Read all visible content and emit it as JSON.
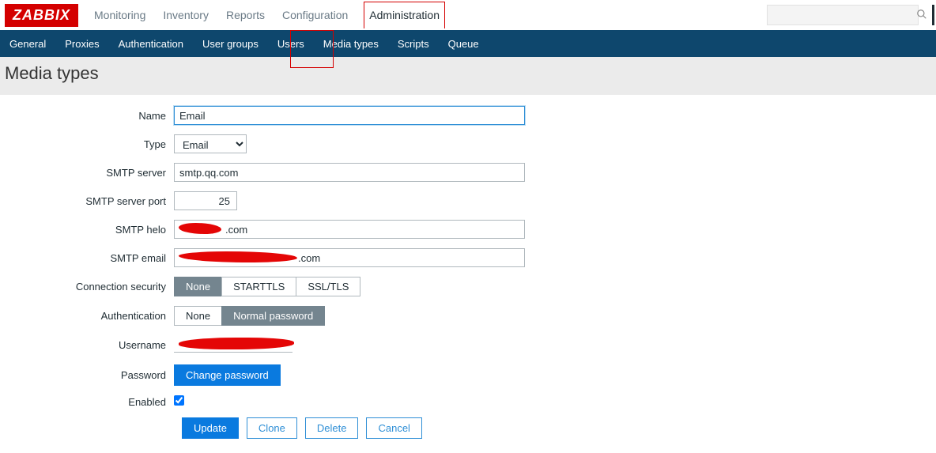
{
  "logo": "ZABBIX",
  "topnav": {
    "monitoring": "Monitoring",
    "inventory": "Inventory",
    "reports": "Reports",
    "configuration": "Configuration",
    "administration": "Administration"
  },
  "subnav": {
    "general": "General",
    "proxies": "Proxies",
    "authentication": "Authentication",
    "usergroups": "User groups",
    "users": "Users",
    "mediatypes": "Media types",
    "scripts": "Scripts",
    "queue": "Queue"
  },
  "page_title": "Media types",
  "labels": {
    "name": "Name",
    "type": "Type",
    "smtp_server": "SMTP server",
    "smtp_port": "SMTP server port",
    "smtp_helo": "SMTP helo",
    "smtp_email": "SMTP email",
    "conn_sec": "Connection security",
    "auth": "Authentication",
    "username": "Username",
    "password": "Password",
    "enabled": "Enabled"
  },
  "values": {
    "name": "Email",
    "type": "Email",
    "smtp_server": "smtp.qq.com",
    "smtp_port": "25",
    "smtp_helo_suffix": ".com",
    "smtp_email_suffix": ".com",
    "username": "",
    "enabled": true
  },
  "options": {
    "conn_sec": {
      "none": "None",
      "starttls": "STARTTLS",
      "ssltls": "SSL/TLS",
      "selected": "none"
    },
    "auth": {
      "none": "None",
      "normal": "Normal password",
      "selected": "normal"
    }
  },
  "buttons": {
    "change_password": "Change password",
    "update": "Update",
    "clone": "Clone",
    "delete": "Delete",
    "cancel": "Cancel"
  },
  "search": {
    "placeholder": ""
  },
  "icons": {
    "search": "search-icon"
  }
}
